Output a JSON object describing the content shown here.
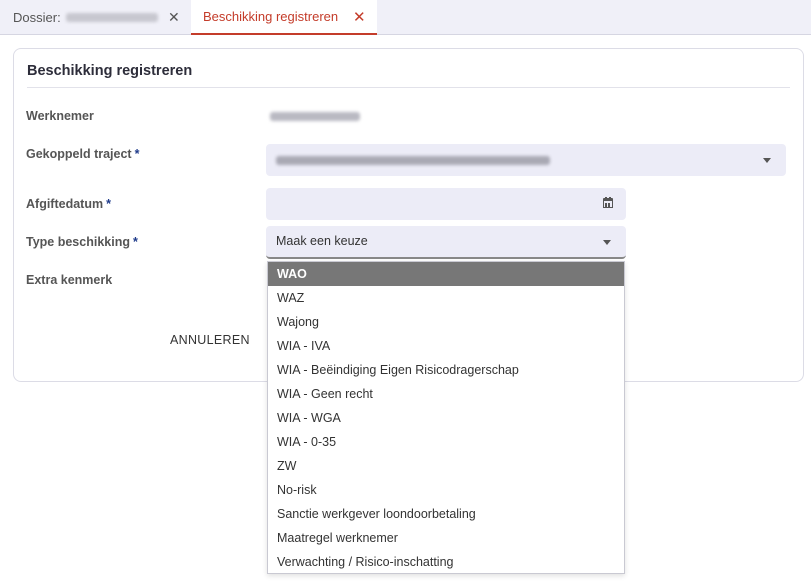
{
  "tabs": [
    {
      "label": "Dossier:",
      "active": false
    },
    {
      "label": "Beschikking registreren",
      "active": true
    }
  ],
  "tab_close_glyph": "✕",
  "card": {
    "title": "Beschikking registreren"
  },
  "form": {
    "werknemer_label": "Werknemer",
    "traject_label": "Gekoppeld traject",
    "afgiftedatum_label": "Afgiftedatum",
    "type_label": "Type beschikking",
    "kenmerk_label": "Extra kenmerk",
    "required_mark": "*",
    "type_placeholder": "Maak een keuze"
  },
  "buttons": {
    "cancel": "ANNULEREN"
  },
  "dropdown": {
    "selected_index": 0,
    "options": [
      "WAO",
      "WAZ",
      "Wajong",
      "WIA - IVA",
      "WIA - Beëindiging Eigen Risicodragerschap",
      "WIA - Geen recht",
      "WIA - WGA",
      "WIA - 0-35",
      "ZW",
      "No-risk",
      "Sanctie werkgever loondoorbetaling",
      "Maatregel werknemer",
      "Verwachting / Risico-inschatting"
    ]
  },
  "colors": {
    "accent": "#c43c2a",
    "required": "#1e3a8a",
    "field_bg": "#ececf7",
    "selected_option_bg": "#777777"
  },
  "icons": {
    "tab_close": "close-icon",
    "select": "chevron-down-icon",
    "date": "calendar-icon"
  }
}
